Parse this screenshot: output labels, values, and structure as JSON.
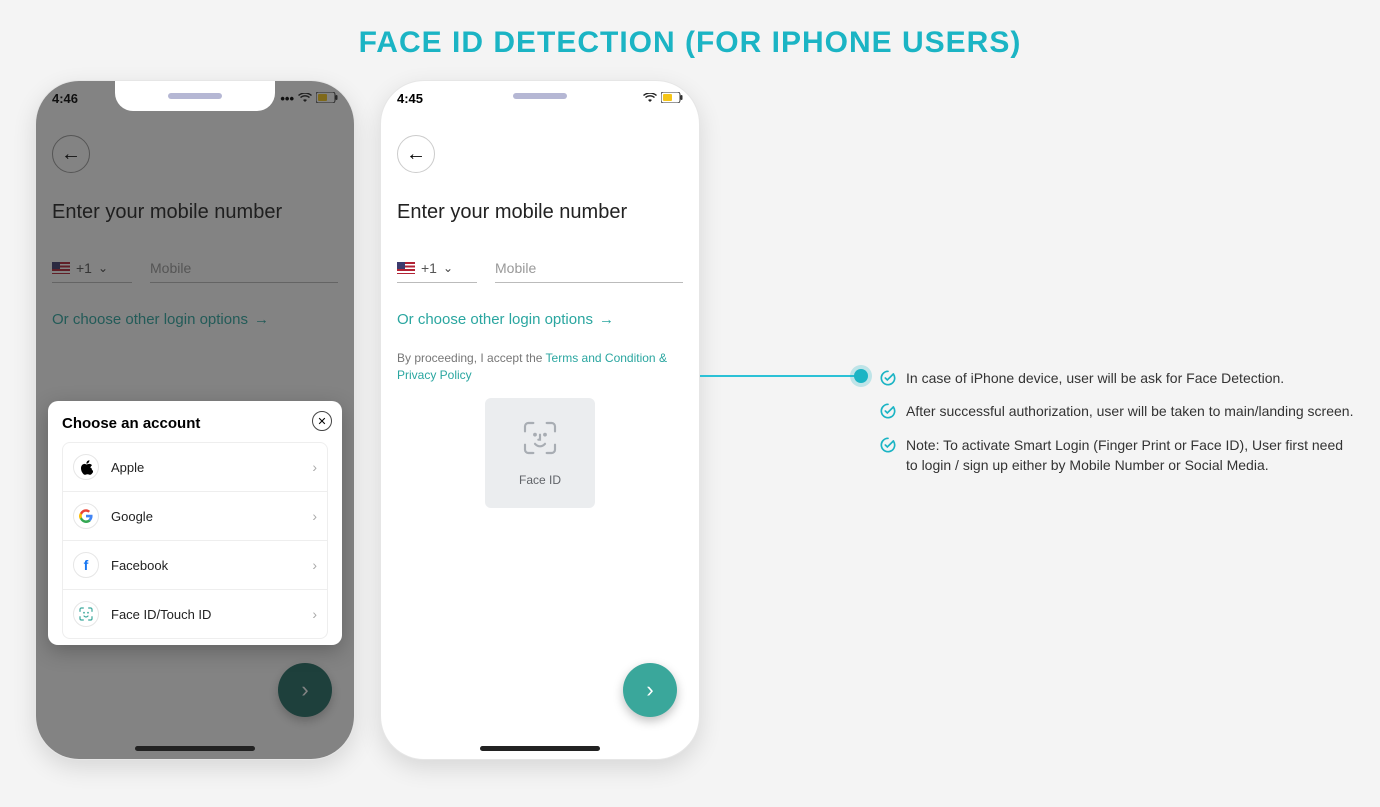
{
  "title": "FACE ID DETECTION (FOR IPHONE USERS)",
  "status_time_left": "4:46",
  "status_time_right": "4:45",
  "heading": "Enter your mobile number",
  "country_code": "+1",
  "mobile_placeholder": "Mobile",
  "other_login_text": "Or choose other login options",
  "terms_prefix": "By proceeding, I accept the ",
  "terms_link": "Terms and Condition & Privacy Policy",
  "faceid_label": "Face ID",
  "sheet_title": "Choose an account",
  "accounts": [
    {
      "label": "Apple"
    },
    {
      "label": "Google"
    },
    {
      "label": "Facebook"
    },
    {
      "label": "Face ID/Touch ID"
    }
  ],
  "notes": [
    "In case of iPhone device, user will be ask for Face Detection.",
    "After successful authorization, user will be taken to main/landing screen.",
    "Note: To activate Smart Login (Finger Print or Face ID), User first need to login / sign up either by Mobile Number or Social Media."
  ]
}
